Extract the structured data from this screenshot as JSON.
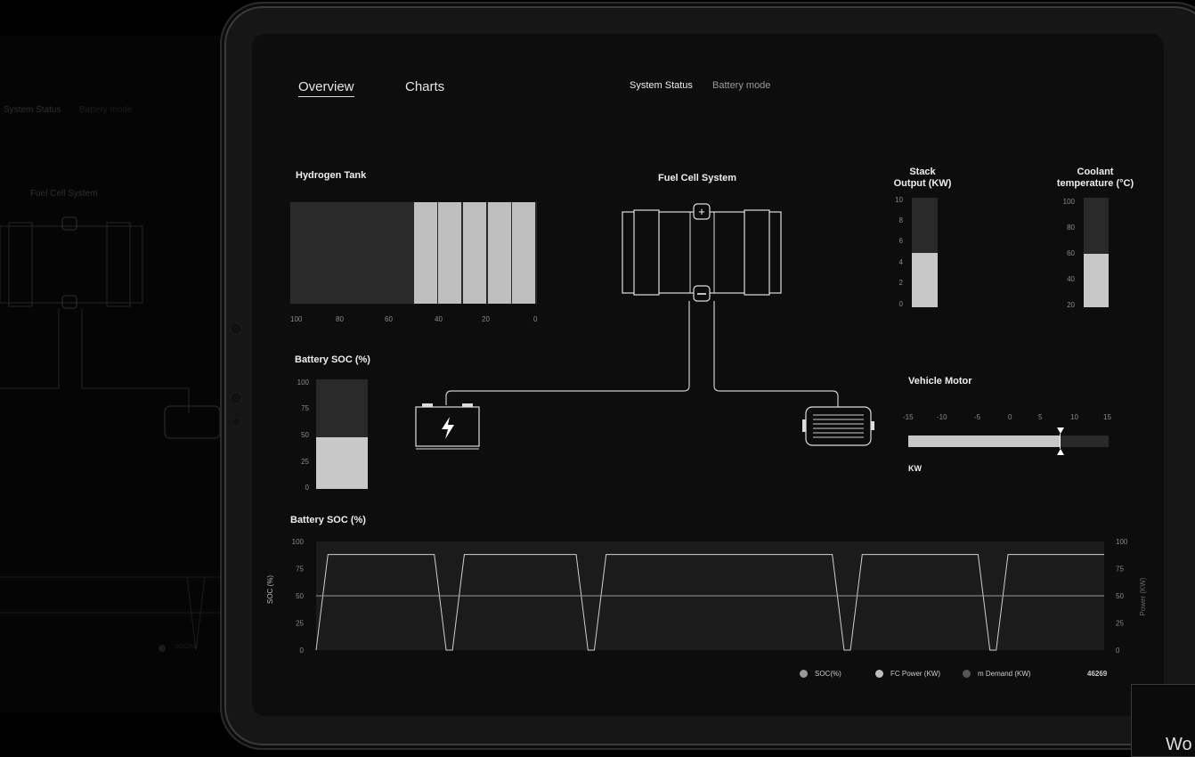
{
  "background_tablet": {
    "tab_system_status": "System Status",
    "tab_battery_mode": "Battery mode",
    "fuel_cell_label": "Fuel Cell System",
    "legend": "SOC(%)"
  },
  "nav": {
    "tabs": [
      {
        "label": "Overview",
        "active": true
      },
      {
        "label": "Charts",
        "active": false
      }
    ],
    "system_status": "System Status",
    "battery_mode": "Battery mode"
  },
  "hydrogen_tank": {
    "title": "Hydrogen Tank",
    "ticks": [
      "100",
      "80",
      "60",
      "40",
      "20",
      "0"
    ],
    "level_percent": 50,
    "segments": 10
  },
  "fuel_cell": {
    "title": "Fuel Cell System"
  },
  "stack_output": {
    "title_line1": "Stack",
    "title_line2": "Output (KW)",
    "ticks": [
      "10",
      "8",
      "6",
      "4",
      "2",
      "0"
    ],
    "value": 5
  },
  "coolant": {
    "title_line1": "Coolant",
    "title_line2": "temperature (°C)",
    "ticks": [
      "100",
      "80",
      "60",
      "40",
      "20"
    ],
    "value": 59
  },
  "battery_soc": {
    "title": "Battery SOC (%)",
    "ticks": [
      "100",
      "75",
      "50",
      "25",
      "0"
    ],
    "value": 47
  },
  "vehicle_motor": {
    "title": "Vehicle Motor",
    "ticks": [
      "-15",
      "-10",
      "-5",
      "0",
      "5",
      "10",
      "15"
    ],
    "value": 10,
    "unit": "KW"
  },
  "soc_chart_title": "Battery SOC (%)",
  "legend": {
    "items": [
      {
        "label": "SOC(%)",
        "color": "#9a9a9a"
      },
      {
        "label": "FC Power (KW)",
        "color": "#bdbdbd"
      },
      {
        "label": "m Demand (KW)",
        "color": "#555555"
      }
    ],
    "counter": "46269"
  },
  "corner_text": "Wo",
  "chart_data": {
    "type": "line",
    "title": "Battery SOC (%)",
    "ylabel": "SOC (%)",
    "y2label": "Power (KW)",
    "ylim": [
      0,
      100
    ],
    "y2lim": [
      0,
      100
    ],
    "yticks": [
      "100",
      "75",
      "50",
      "25",
      "0"
    ],
    "y2ticks": [
      "100",
      "75",
      "50",
      "25",
      "0"
    ],
    "x": [
      0,
      1.5,
      15,
      16.5,
      17.3,
      18.8,
      33,
      34.5,
      35.3,
      36.8,
      65.5,
      67,
      67.8,
      69.3,
      84,
      85.5,
      86.3,
      87.8,
      100
    ],
    "series": [
      {
        "values": [
          0,
          88,
          88,
          0,
          0,
          88,
          88,
          0,
          0,
          88,
          88,
          0,
          0,
          88,
          88,
          0,
          0,
          88,
          88
        ]
      },
      {
        "values": [
          50,
          50,
          50,
          50,
          50,
          50,
          50,
          50,
          50,
          50,
          50,
          50,
          50,
          50,
          50,
          50,
          50,
          50,
          50
        ]
      }
    ]
  }
}
